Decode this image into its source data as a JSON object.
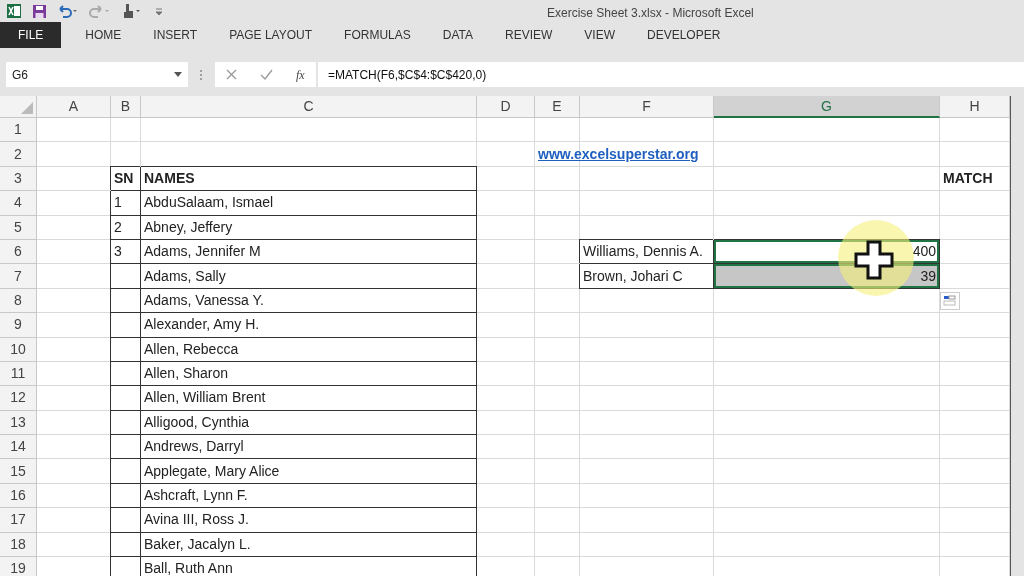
{
  "window": {
    "title": "Exercise Sheet 3.xlsx - Microsoft Excel"
  },
  "ribbon_tabs": [
    {
      "label": "FILE",
      "kind": "file"
    },
    {
      "label": "HOME",
      "kind": "tab"
    },
    {
      "label": "INSERT",
      "kind": "tab"
    },
    {
      "label": "PAGE LAYOUT",
      "kind": "tab"
    },
    {
      "label": "FORMULAS",
      "kind": "tab"
    },
    {
      "label": "DATA",
      "kind": "tab"
    },
    {
      "label": "REVIEW",
      "kind": "tab"
    },
    {
      "label": "VIEW",
      "kind": "tab"
    },
    {
      "label": "DEVELOPER",
      "kind": "tab"
    }
  ],
  "formula_bar": {
    "name_box": "G6",
    "fx": "fx",
    "formula": "=MATCH(F6,$C$4:$C$420,0)"
  },
  "columns": [
    {
      "label": "A",
      "selected": false
    },
    {
      "label": "B",
      "selected": false
    },
    {
      "label": "C",
      "selected": false
    },
    {
      "label": "D",
      "selected": false
    },
    {
      "label": "E",
      "selected": false
    },
    {
      "label": "F",
      "selected": false
    },
    {
      "label": "G",
      "selected": true
    },
    {
      "label": "H",
      "selected": false
    }
  ],
  "rows": [
    "1",
    "2",
    "3",
    "4",
    "5",
    "6",
    "7",
    "8",
    "9",
    "10",
    "11",
    "12",
    "13",
    "14",
    "15",
    "16",
    "17",
    "18",
    "19"
  ],
  "link": "www.excelsuperstar.org",
  "match_label": "MATCH",
  "names_table": {
    "header": [
      "SN",
      "NAMES"
    ],
    "rows": [
      {
        "sn": "1",
        "name": "AbduSalaam, Ismael"
      },
      {
        "sn": "2",
        "name": "Abney, Jeffery"
      },
      {
        "sn": "3",
        "name": "Adams, Jennifer M"
      },
      {
        "name": "Adams, Sally"
      },
      {
        "name": "Adams, Vanessa Y."
      },
      {
        "name": "Alexander, Amy H."
      },
      {
        "name": "Allen, Rebecca"
      },
      {
        "name": "Allen, Sharon"
      },
      {
        "name": "Allen, William Brent"
      },
      {
        "name": "Alligood, Cynthia"
      },
      {
        "name": "Andrews, Darryl"
      },
      {
        "name": "Applegate, Mary Alice"
      },
      {
        "name": "Ashcraft, Lynn F."
      },
      {
        "name": "Avina III, Ross J."
      },
      {
        "name": "Baker, Jacalyn L."
      },
      {
        "name": "Ball, Ruth Ann"
      }
    ]
  },
  "lookup": [
    {
      "name": "Williams, Dennis A.",
      "result": "400",
      "selected": true,
      "active": true
    },
    {
      "name": "Brown, Johari C",
      "result": "39",
      "selected": true,
      "active": false
    }
  ]
}
